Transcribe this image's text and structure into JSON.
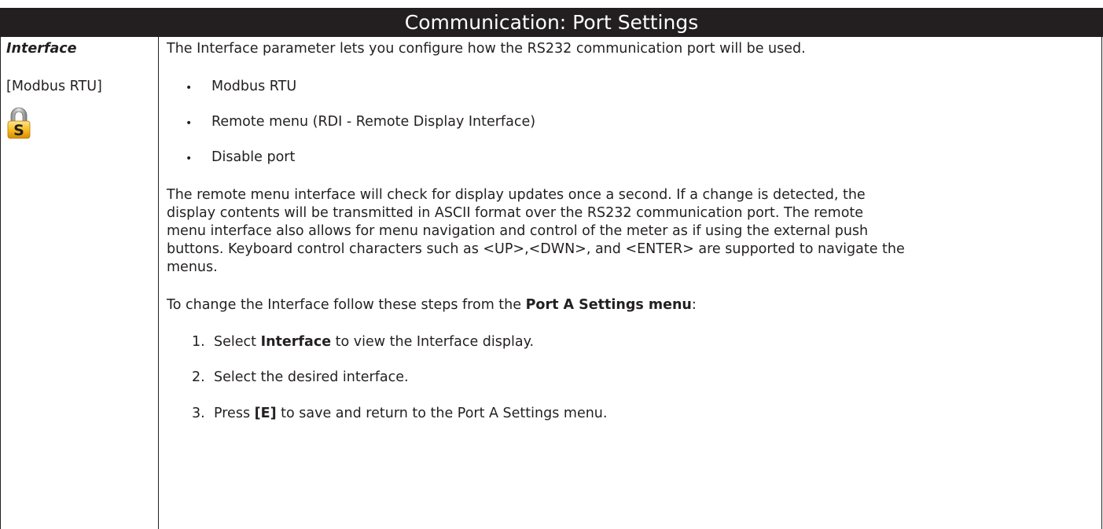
{
  "header": {
    "title": "Communication: Port Settings"
  },
  "parameter": {
    "name": "Interface",
    "default_value": "[Modbus RTU]",
    "lock_letter": "S",
    "lock_icon": "padlock-s-icon"
  },
  "description": {
    "intro": "The Interface parameter lets you configure how the RS232 communication port will be used.",
    "options": [
      "Modbus RTU",
      "Remote menu (RDI - Remote Display Interface)",
      "Disable port"
    ],
    "remote_paragraph_lines": [
      "The remote menu interface will check for display updates once a second. If a change is detected, the",
      "display contents will be transmitted in ASCII format over the RS232 communication port. The remote",
      "menu interface also allows for menu navigation and control of the meter as if using the external push",
      "buttons. Keyboard control characters such as <UP>,<DWN>, and <ENTER> are supported to navigate the",
      "menus."
    ],
    "steps_intro_pre": "To change the Interface follow these steps from the ",
    "steps_intro_bold": "Port A Settings menu",
    "steps_intro_post": ":",
    "steps": [
      {
        "num": "1.",
        "pre": "Select ",
        "bold": "Interface",
        "post": " to view the Interface display."
      },
      {
        "num": "2.",
        "pre": "Select the desired interface.",
        "bold": "",
        "post": ""
      },
      {
        "num": "3.",
        "pre": "Press ",
        "bold": "[E]",
        "post": " to save and return to the Port A Settings menu."
      }
    ]
  }
}
